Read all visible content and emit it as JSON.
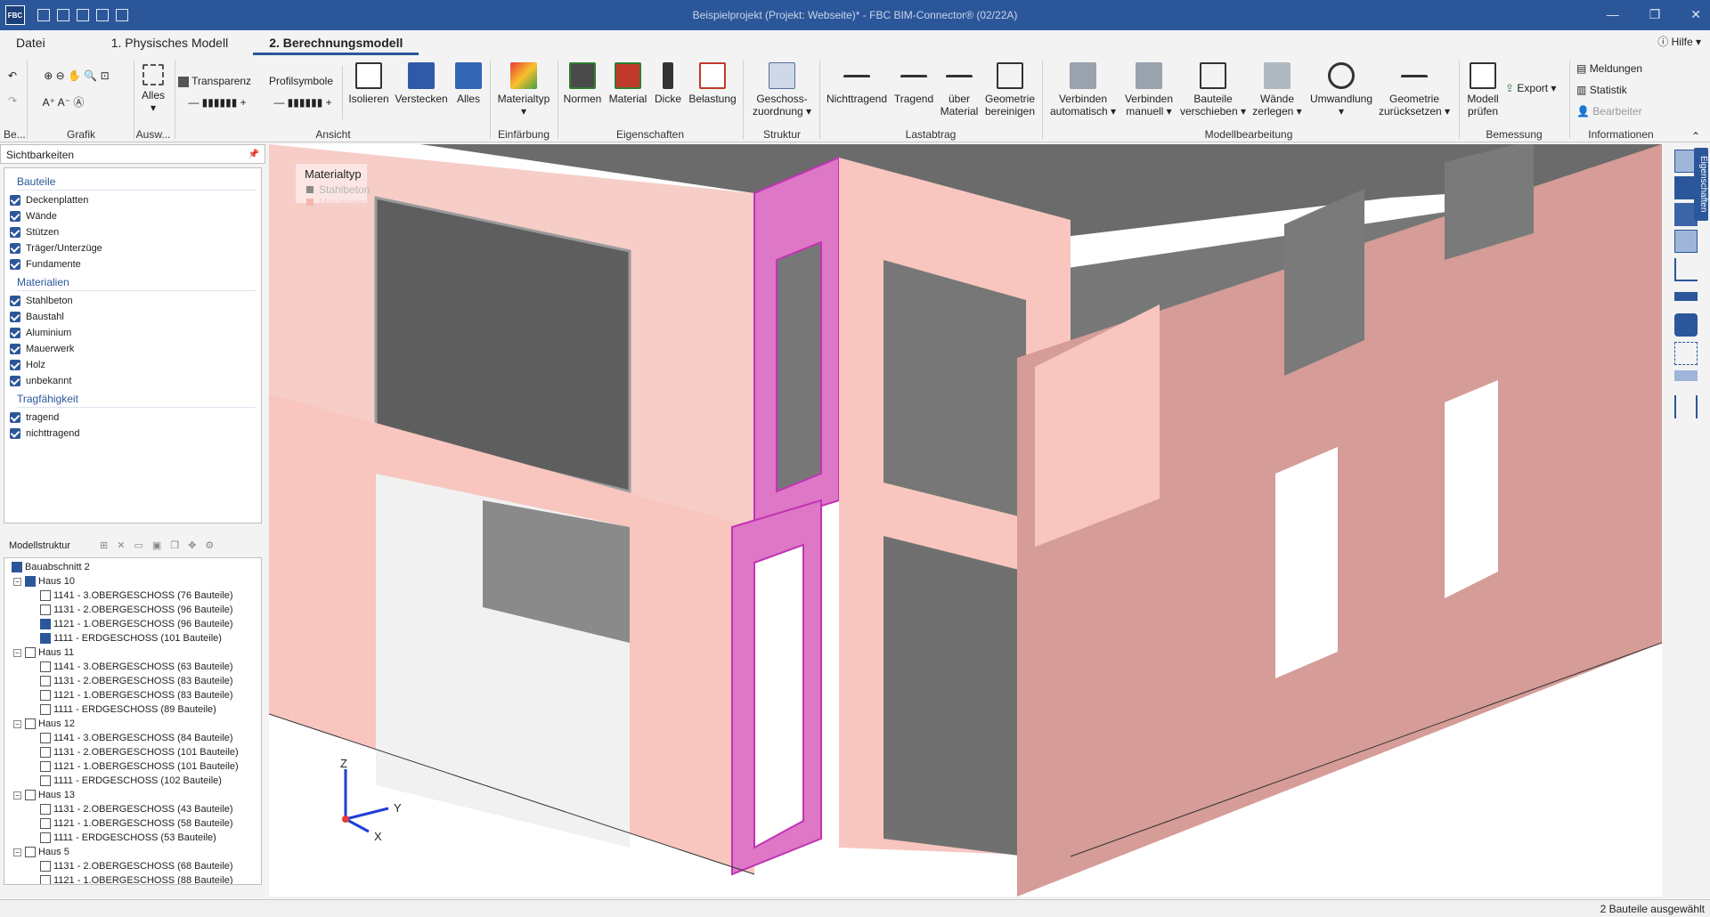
{
  "window": {
    "logo": "FBC",
    "title": "Beispielprojekt (Projekt: Webseite)*  -  FBC BIM-Connector® (02/22A)"
  },
  "menu": {
    "tabs": [
      "Datei",
      "1. Physisches Modell",
      "2. Berechnungsmodell"
    ],
    "active_tab": "2. Berechnungsmodell",
    "help": "Hilfe"
  },
  "ribbon": {
    "groups": {
      "be": "Be...",
      "grafik": "Grafik",
      "ausw": "Ausw...",
      "ansicht": "Ansicht",
      "einfaerbung": "Einfärbung",
      "eigenschaften": "Eigenschaften",
      "struktur": "Struktur",
      "lastabtrag": "Lastabtrag",
      "modellbearbeitung": "Modellbearbeitung",
      "bemessung": "Bemessung",
      "informationen": "Informationen"
    },
    "buttons": {
      "alles_select": "Alles",
      "transparenz": "Transparenz",
      "profilsymbole": "Profilsymbole",
      "isolieren": "Isolieren",
      "verstecken": "Verstecken",
      "alles_view": "Alles",
      "materialtyp": "Materialtyp",
      "normen": "Normen",
      "material": "Material",
      "dicke": "Dicke",
      "belastung": "Belastung",
      "geschoss_1": "Geschoss-",
      "geschoss_2": "zuordnung",
      "nichttragend": "Nichttragend",
      "tragend": "Tragend",
      "ueber_1": "über",
      "ueber_2": "Material",
      "geobereinigen_1": "Geometrie",
      "geobereinigen_2": "bereinigen",
      "vauto_1": "Verbinden",
      "vauto_2": "automatisch",
      "vman_1": "Verbinden",
      "vman_2": "manuell",
      "bverschieben_1": "Bauteile",
      "bverschieben_2": "verschieben",
      "wzerlegen_1": "Wände",
      "wzerlegen_2": "zerlegen",
      "umwandlung": "Umwandlung",
      "gzurueck_1": "Geometrie",
      "gzurueck_2": "zurücksetzen",
      "mpruefen_1": "Modell",
      "mpruefen_2": "prüfen",
      "export": "Export",
      "meldungen": "Meldungen",
      "statistik": "Statistik",
      "bearbeiter": "Bearbeiter"
    }
  },
  "sichtbarkeiten": {
    "title": "Sichtbarkeiten",
    "sections": [
      {
        "label": "Bauteile",
        "items": [
          "Deckenplatten",
          "Wände",
          "Stützen",
          "Träger/Unterzüge",
          "Fundamente"
        ]
      },
      {
        "label": "Materialien",
        "items": [
          "Stahlbeton",
          "Baustahl",
          "Aluminium",
          "Mauerwerk",
          "Holz",
          "unbekannt"
        ]
      },
      {
        "label": "Tragfähigkeit",
        "items": [
          "tragend",
          "nichttragend"
        ]
      }
    ]
  },
  "modellstruktur": {
    "title": "Modellstruktur",
    "root": "Bauabschnitt 2",
    "houses": [
      {
        "name": "Haus 10",
        "checked": true,
        "floors": [
          {
            "label": "1141 - 3.OBERGESCHOSS (76 Bauteile)",
            "checked": false
          },
          {
            "label": "1131 - 2.OBERGESCHOSS (96 Bauteile)",
            "checked": false
          },
          {
            "label": "1121 - 1.OBERGESCHOSS (96 Bauteile)",
            "checked": true
          },
          {
            "label": "1111 - ERDGESCHOSS (101 Bauteile)",
            "checked": true
          }
        ]
      },
      {
        "name": "Haus 11",
        "checked": false,
        "floors": [
          {
            "label": "1141 - 3.OBERGESCHOSS (63 Bauteile)",
            "checked": false
          },
          {
            "label": "1131 - 2.OBERGESCHOSS (83 Bauteile)",
            "checked": false
          },
          {
            "label": "1121 - 1.OBERGESCHOSS (83 Bauteile)",
            "checked": false
          },
          {
            "label": "1111 - ERDGESCHOSS (89 Bauteile)",
            "checked": false
          }
        ]
      },
      {
        "name": "Haus 12",
        "checked": false,
        "floors": [
          {
            "label": "1141 - 3.OBERGESCHOSS (84 Bauteile)",
            "checked": false
          },
          {
            "label": "1131 - 2.OBERGESCHOSS (101 Bauteile)",
            "checked": false
          },
          {
            "label": "1121 - 1.OBERGESCHOSS (101 Bauteile)",
            "checked": false
          },
          {
            "label": "1111 - ERDGESCHOSS (102 Bauteile)",
            "checked": false
          }
        ]
      },
      {
        "name": "Haus 13",
        "checked": false,
        "floors": [
          {
            "label": "1131 - 2.OBERGESCHOSS (43 Bauteile)",
            "checked": false
          },
          {
            "label": "1121 - 1.OBERGESCHOSS (58 Bauteile)",
            "checked": false
          },
          {
            "label": "1111 - ERDGESCHOSS (53 Bauteile)",
            "checked": false
          }
        ]
      },
      {
        "name": "Haus 5",
        "checked": false,
        "floors": [
          {
            "label": "1131 - 2.OBERGESCHOSS (68 Bauteile)",
            "checked": false
          },
          {
            "label": "1121 - 1.OBERGESCHOSS (88 Bauteile)",
            "checked": false
          }
        ]
      }
    ]
  },
  "viewport": {
    "legend_title": "Materialtyp",
    "legend": [
      {
        "label": "Stahlbeton",
        "color": "#8a8a8a"
      },
      {
        "label": "Mauerwerk",
        "color": "#f4b6ae"
      }
    ],
    "axes": {
      "z": "Z",
      "y": "Y",
      "x": "X"
    },
    "colors": {
      "wall": "#f8c6bf",
      "wall_dark": "#d99f9b",
      "selected": "#d94fc1",
      "slab": "#6c6c6c"
    }
  },
  "right_panel": {
    "properties_tab": "Eigenschaften"
  },
  "status": {
    "selection": "2 Bauteile ausgewählt"
  }
}
